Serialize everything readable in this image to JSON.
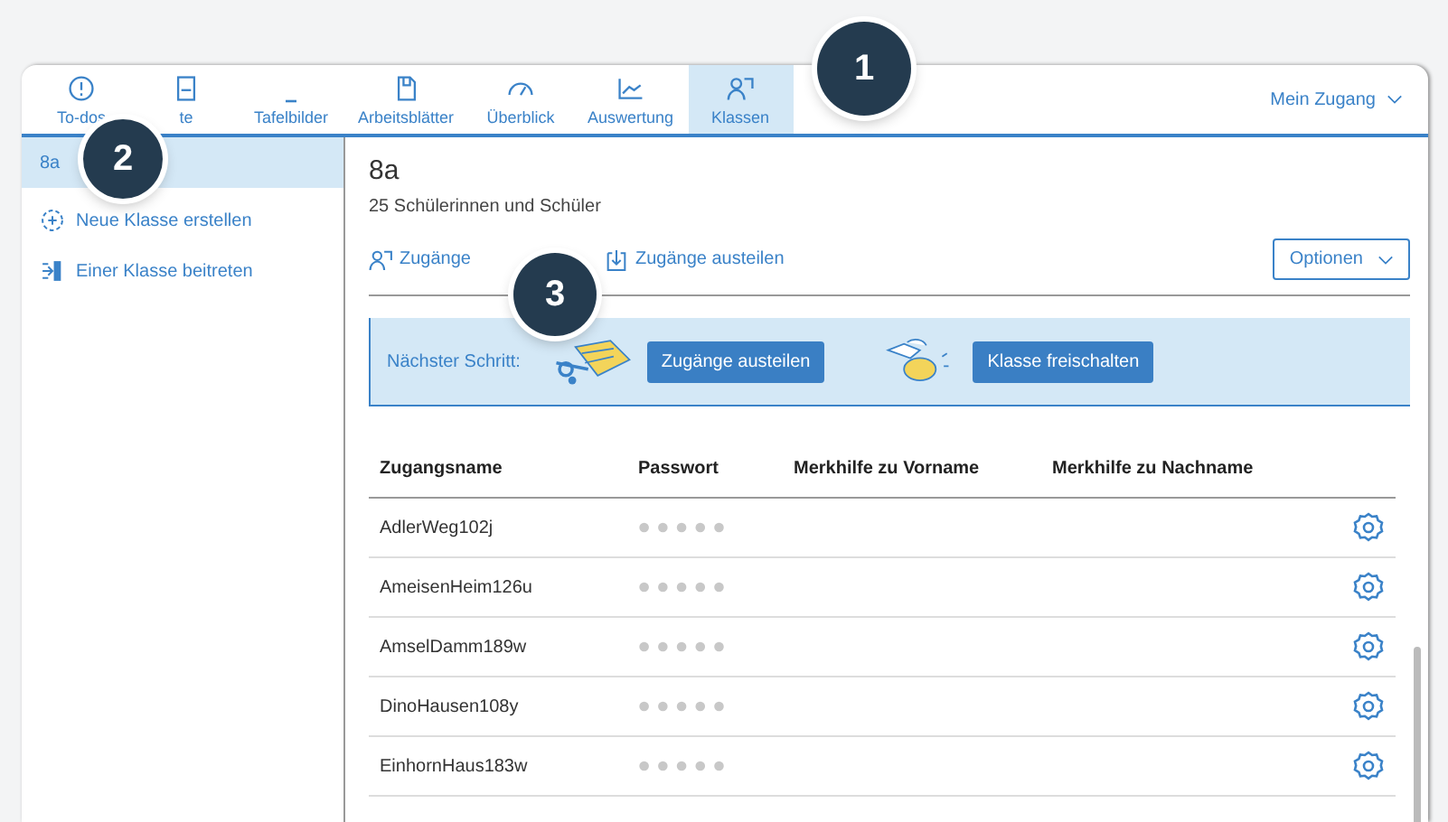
{
  "nav": {
    "tabs": [
      {
        "label": "To-dos",
        "selected": false
      },
      {
        "label": "te",
        "selected": false
      },
      {
        "label": "Tafelbilder",
        "selected": false
      },
      {
        "label": "Arbeitsblätter",
        "selected": false
      },
      {
        "label": "Überblick",
        "selected": false
      },
      {
        "label": "Auswertung",
        "selected": false
      },
      {
        "label": "Klassen",
        "selected": true
      }
    ],
    "account": "Mein Zugang"
  },
  "sidebar": {
    "items": [
      {
        "label": "8a",
        "selected": true
      },
      {
        "label": "Neue Klasse erstellen",
        "selected": false
      },
      {
        "label": "Einer Klasse beitreten",
        "selected": false
      }
    ]
  },
  "main": {
    "title": "8a",
    "subtitle": "25 Schülerinnen und Schüler",
    "actions": [
      "Zugänge",
      "Zugänge austeilen"
    ],
    "options": "Optionen",
    "next_step": {
      "label": "Nächster Schritt:",
      "buttons": [
        "Zugänge austeilen",
        "Klasse freischalten"
      ]
    },
    "table": {
      "columns": [
        "Zugangsname",
        "Passwort",
        "Merkhilfe zu Vorname",
        "Merkhilfe zu Nachname"
      ],
      "rows": [
        {
          "name": "AdlerWeg102j"
        },
        {
          "name": "AmeisenHeim126u"
        },
        {
          "name": "AmselDamm189w"
        },
        {
          "name": "DinoHausen108y"
        },
        {
          "name": "EinhornHaus183w"
        }
      ]
    }
  },
  "callouts": [
    "1",
    "2",
    "3"
  ]
}
